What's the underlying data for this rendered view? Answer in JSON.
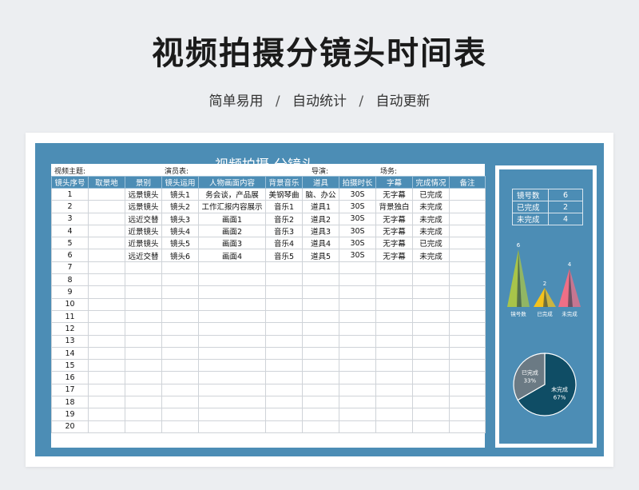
{
  "header": {
    "title": "视频拍摄分镜头时间表",
    "tags": [
      "简单易用",
      "自动统计",
      "自动更新"
    ],
    "separator": "/"
  },
  "sheet": {
    "title": "视频拍摄-分镜头",
    "info": {
      "theme_label": "视频主题:",
      "actor_label": "演员表:",
      "director_label": "导演:",
      "scene_label": "场务:"
    },
    "columns": [
      "镜头序号",
      "取景地",
      "景别",
      "镜头运用",
      "人物画面内容",
      "背景音乐",
      "道具",
      "拍摄时长",
      "字幕",
      "完成情况",
      "备注"
    ],
    "rows": [
      [
        "1",
        "",
        "远景镜头",
        "镜头1",
        "务会谈，产品展",
        "美钢琴曲",
        "脑、办公",
        "30S",
        "无字幕",
        "已完成",
        ""
      ],
      [
        "2",
        "",
        "远景镜头",
        "镜头2",
        "工作汇报内容展示",
        "音乐1",
        "道具1",
        "30S",
        "背景独白",
        "未完成",
        ""
      ],
      [
        "3",
        "",
        "远近交替",
        "镜头3",
        "画面1",
        "音乐2",
        "道具2",
        "30S",
        "无字幕",
        "未完成",
        ""
      ],
      [
        "4",
        "",
        "近景镜头",
        "镜头4",
        "画面2",
        "音乐3",
        "道具3",
        "30S",
        "无字幕",
        "未完成",
        ""
      ],
      [
        "5",
        "",
        "近景镜头",
        "镜头5",
        "画面3",
        "音乐4",
        "道具4",
        "30S",
        "无字幕",
        "已完成",
        ""
      ],
      [
        "6",
        "",
        "远近交替",
        "镜头6",
        "画面4",
        "音乐5",
        "道具5",
        "30S",
        "无字幕",
        "未完成",
        ""
      ],
      [
        "7",
        "",
        "",
        "",
        "",
        "",
        "",
        "",
        "",
        "",
        ""
      ],
      [
        "8",
        "",
        "",
        "",
        "",
        "",
        "",
        "",
        "",
        "",
        ""
      ],
      [
        "9",
        "",
        "",
        "",
        "",
        "",
        "",
        "",
        "",
        "",
        ""
      ],
      [
        "10",
        "",
        "",
        "",
        "",
        "",
        "",
        "",
        "",
        "",
        ""
      ],
      [
        "11",
        "",
        "",
        "",
        "",
        "",
        "",
        "",
        "",
        "",
        ""
      ],
      [
        "12",
        "",
        "",
        "",
        "",
        "",
        "",
        "",
        "",
        "",
        ""
      ],
      [
        "13",
        "",
        "",
        "",
        "",
        "",
        "",
        "",
        "",
        "",
        ""
      ],
      [
        "14",
        "",
        "",
        "",
        "",
        "",
        "",
        "",
        "",
        "",
        ""
      ],
      [
        "15",
        "",
        "",
        "",
        "",
        "",
        "",
        "",
        "",
        "",
        ""
      ],
      [
        "16",
        "",
        "",
        "",
        "",
        "",
        "",
        "",
        "",
        "",
        ""
      ],
      [
        "17",
        "",
        "",
        "",
        "",
        "",
        "",
        "",
        "",
        "",
        ""
      ],
      [
        "18",
        "",
        "",
        "",
        "",
        "",
        "",
        "",
        "",
        "",
        ""
      ],
      [
        "19",
        "",
        "",
        "",
        "",
        "",
        "",
        "",
        "",
        "",
        ""
      ],
      [
        "20",
        "",
        "",
        "",
        "",
        "",
        "",
        "",
        "",
        "",
        ""
      ]
    ]
  },
  "stats": [
    {
      "label": "镜号数",
      "value": "6"
    },
    {
      "label": "已完成",
      "value": "2"
    },
    {
      "label": "未完成",
      "value": "4"
    }
  ],
  "colors": {
    "frame": "#4c8db5",
    "tri_total": "#a8c44a",
    "tri_done": "#f4c21c",
    "tri_undone": "#ef6f86",
    "pie_undone": "#0f4d65",
    "pie_done": "#6b7a84"
  },
  "chart_data": [
    {
      "type": "bar",
      "categories": [
        "镜号数",
        "已完成",
        "未完成"
      ],
      "values": [
        6,
        2,
        4
      ],
      "title": "",
      "xlabel": "",
      "ylabel": "",
      "ylim": [
        0,
        6
      ],
      "grid": false
    },
    {
      "type": "pie",
      "categories": [
        "未完成",
        "已完成"
      ],
      "values": [
        4,
        2
      ],
      "percent_labels": [
        "67%",
        "33%"
      ],
      "title": ""
    }
  ]
}
